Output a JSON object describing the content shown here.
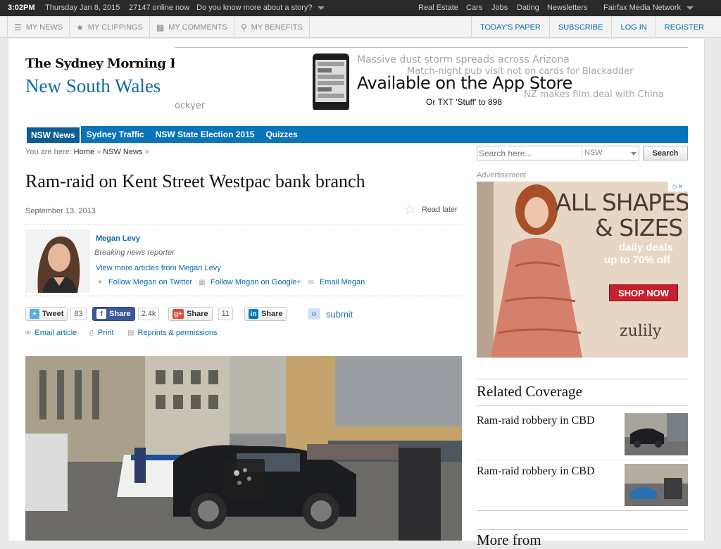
{
  "topbar": {
    "time": "3:02PM",
    "date": "Thursday Jan 8, 2015",
    "online": "27147 online now",
    "story_prompt": "Do you know more about a story?",
    "links": [
      "Real Estate",
      "Cars",
      "Jobs",
      "Dating",
      "Newsletters"
    ],
    "network": "Fairfax Media Network"
  },
  "usernav": {
    "left": [
      {
        "label": "MY NEWS",
        "icon": "list-icon"
      },
      {
        "label": "MY CLIPPINGS",
        "icon": "star-icon"
      },
      {
        "label": "MY COMMENTS",
        "icon": "comments-icon"
      },
      {
        "label": "MY BENEFITS",
        "icon": "trophy-icon"
      }
    ],
    "right": [
      "TODAY'S PAPER",
      "SUBSCRIBE",
      "LOG IN",
      "REGISTER"
    ]
  },
  "masthead": {
    "brand": "The Sydney Morning Herald",
    "section": "New South Wales"
  },
  "banner": {
    "ghost_lines": [
      "Massive dust storm spreads across Arizona",
      "Match-night pub visit not on cards for Blackadder",
      "NZ makes film deal with China",
      "ockyer"
    ],
    "headline": "Available on the App Store",
    "sms": "Or TXT 'Stuff' to 898"
  },
  "sections": [
    "NSW News",
    "Sydney Traffic",
    "NSW State Election 2015",
    "Quizzes"
  ],
  "breadcrumb": {
    "prefix": "You are here:",
    "items": [
      "Home",
      "NSW News"
    ]
  },
  "search": {
    "placeholder": "Search here...",
    "region": "NSW",
    "button": "Search"
  },
  "article": {
    "headline": "Ram-raid on Kent Street Westpac bank branch",
    "date": "September 13, 2013",
    "read_later": "Read later",
    "author": {
      "name": "Megan Levy",
      "role": "Breaking news reporter",
      "more": "View more articles from Megan Levy",
      "twitter": "Follow Megan on Twitter",
      "google": "Follow Megan on Google+",
      "email": "Email Megan"
    },
    "share": {
      "tweet": "Tweet",
      "tweet_count": "83",
      "fb": "Share",
      "fb_count": "2.4k",
      "gplus": "Share",
      "gplus_count": "11",
      "linkedin": "Share",
      "reddit": "submit"
    },
    "utils": [
      "Email article",
      "Print",
      "Reprints & permissions"
    ]
  },
  "sidebar": {
    "ad_label": "Advertisement",
    "ad": {
      "line1": "ALL SHAPES",
      "line2": "& SIZES",
      "line3": "daily deals",
      "line4": "up to 70% off",
      "cta": "SHOP NOW",
      "brand": "zulily"
    },
    "related_title": "Related Coverage",
    "related": [
      "Ram-raid robbery in CBD",
      "Ram-raid robbery in CBD"
    ],
    "more_title": "More from"
  }
}
